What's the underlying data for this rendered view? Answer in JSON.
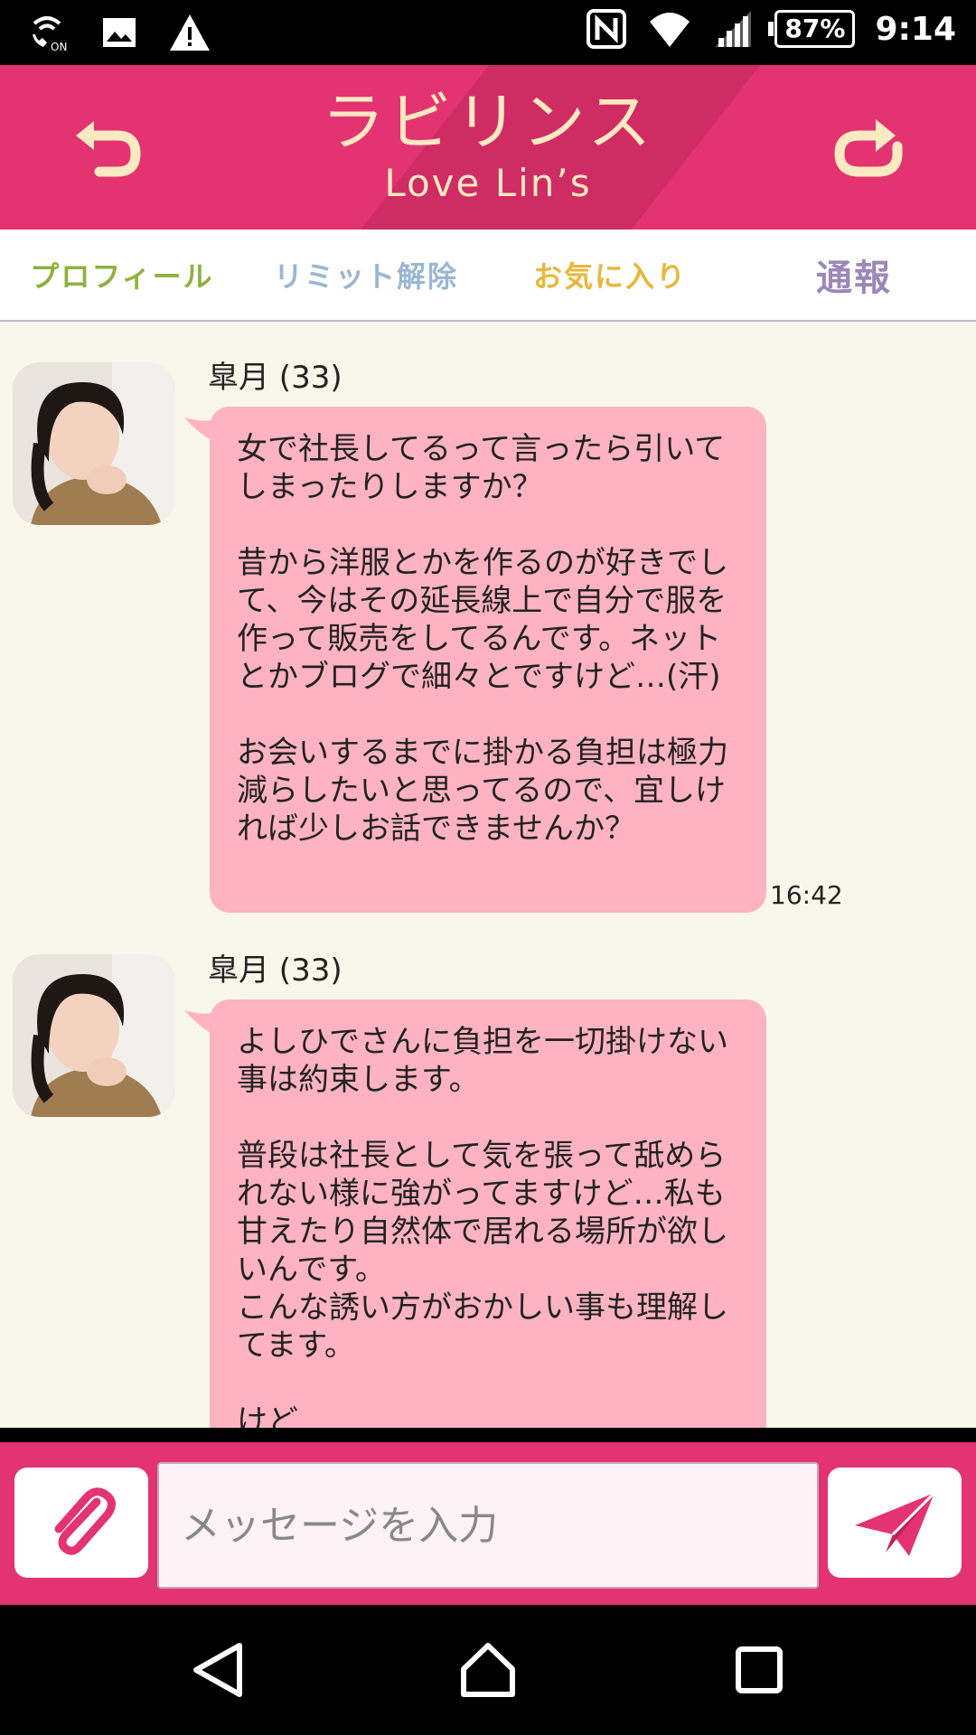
{
  "status_bar": {
    "battery": "87%",
    "time": "9:14",
    "left_icons": [
      "wifi-calling-on-icon",
      "image-icon",
      "warning-icon"
    ],
    "right_icons": [
      "nfc-icon",
      "wifi-icon",
      "signal-icon",
      "battery-icon"
    ]
  },
  "header": {
    "title": "ラビリンス",
    "subtitle": "Love Lin’s",
    "accent_color": "#e33371",
    "logo_color": "#fbe9c2"
  },
  "tabs": [
    {
      "label": "プロフィール",
      "color": "#8db23e"
    },
    {
      "label": "リミット解除",
      "color": "#9ab7d2"
    },
    {
      "label": "お気に入り",
      "color": "#e7b83d"
    },
    {
      "label": "通報",
      "color": "#9b88b8"
    }
  ],
  "messages": [
    {
      "sender": "皐月 (33)",
      "text": "女で社長してるって言ったら引いてしまったりしますか？\n\n昔から洋服とかを作るのが好きでして、今はその延長線上で自分で服を作って販売をしてるんです。ネットとかブログで細々とですけど…(汗)\n\nお会いするまでに掛かる負担は極力減らしたいと思ってるので、宜しければ少しお話できませんか？",
      "time": "16:42"
    },
    {
      "sender": "皐月 (33)",
      "text": "よしひでさんに負担を一切掛けない事は約束します。\n\n普段は社長として気を張って舐められない様に強がってますけど…私も甘えたり自然体で居れる場所が欲しいんです。\nこんな誘い方がおかしい事も理解してます。\n\nけど",
      "time": ""
    }
  ],
  "input": {
    "placeholder": "メッセージを入力"
  }
}
